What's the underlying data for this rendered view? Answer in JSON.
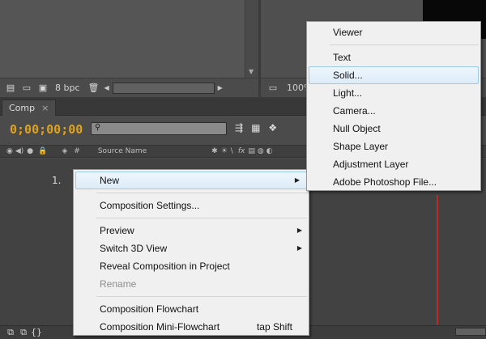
{
  "project_panel": {
    "bpc_label": "8 bpc"
  },
  "viewer": {
    "zoom_label": "100%"
  },
  "comp_panel": {
    "tab_label": "Comp",
    "tab_close": "×",
    "timecode": "0;00;00;00",
    "columns": {
      "hash": "#",
      "source_name": "Source Name",
      "fx": "fx"
    },
    "layer_number": "1."
  },
  "context_menu": {
    "items": [
      {
        "label": "New",
        "submenu": true,
        "highlighted": true
      },
      {
        "label": "Composition Settings..."
      },
      {
        "label": "Preview",
        "submenu": true
      },
      {
        "label": "Switch 3D View",
        "submenu": true
      },
      {
        "label": "Reveal Composition in Project"
      },
      {
        "label": "Rename",
        "disabled": true
      },
      {
        "label": "Composition Flowchart"
      },
      {
        "label": "Composition Mini-Flowchart",
        "shortcut": "tap Shift"
      }
    ]
  },
  "submenu": {
    "items": [
      {
        "label": "Viewer"
      },
      {
        "label": "Text"
      },
      {
        "label": "Solid...",
        "highlighted": true
      },
      {
        "label": "Light..."
      },
      {
        "label": "Camera..."
      },
      {
        "label": "Null Object"
      },
      {
        "label": "Shape Layer"
      },
      {
        "label": "Adjustment Layer"
      },
      {
        "label": "Adobe Photoshop File..."
      }
    ]
  },
  "colors": {
    "timecode": "#e0a21b",
    "highlight": "#dcecf8",
    "time_indicator": "#b92b2b"
  }
}
